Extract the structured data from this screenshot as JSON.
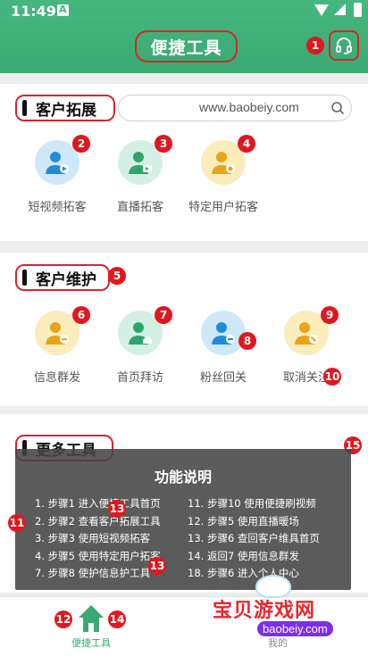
{
  "status_bar": {
    "time": "11:49"
  },
  "header": {
    "title": "便捷工具"
  },
  "sections": {
    "expand": {
      "title": "客户拓展",
      "search_url": "www.baobeiy.com",
      "tools": [
        {
          "label": "短视频拓客",
          "icon": "user-video-icon",
          "color": "blue"
        },
        {
          "label": "直播拓客",
          "icon": "user-live-icon",
          "color": "green"
        },
        {
          "label": "特定用户拓客",
          "icon": "user-target-icon",
          "color": "yellow"
        }
      ]
    },
    "maintain": {
      "title": "客户维护",
      "tools": [
        {
          "label": "信息群发",
          "icon": "user-message-icon",
          "color": "yellow"
        },
        {
          "label": "首页拜访",
          "icon": "user-home-icon",
          "color": "green"
        },
        {
          "label": "粉丝回关",
          "icon": "user-follow-icon",
          "color": "blue"
        },
        {
          "label": "取消关注",
          "icon": "user-unfollow-icon",
          "color": "yellow"
        }
      ]
    },
    "more": {
      "title": "更多工具"
    }
  },
  "overlay": {
    "title": "功能说明",
    "left_steps": [
      "1. 步骤1 进入便捷工具首页",
      "2. 步骤2 查看客户拓展工具",
      "3. 步骤3 使用短视频拓客",
      "4. 步骤5 使用特定用户拓客",
      "7. 步骤8 使护信息护工具"
    ],
    "right_steps": [
      "11. 步骤10 使用便捷刷视频",
      "12. 步骤5 使用直播暖场",
      "13. 步骤6 查回客户维具首页",
      "14. 返回7 使用信息群发",
      "18. 步骤6 进入个人中心"
    ]
  },
  "bottom_nav": {
    "home_label": "便捷工具",
    "mine_label": "我的"
  },
  "badges": {
    "b1": "1",
    "b2": "2",
    "b3": "3",
    "b4": "4",
    "b5": "5",
    "b6": "6",
    "b7": "7",
    "b8": "8",
    "b9": "9",
    "b10": "10",
    "b11": "11",
    "b12": "12",
    "b13a": "13",
    "b13b": "13",
    "b14": "14",
    "b15": "15"
  },
  "watermark": {
    "text": "宝贝游戏网",
    "url": "baobeiy.com"
  },
  "colors": {
    "brand_green": "#3aa972",
    "annotation_red": "#d7262e"
  }
}
